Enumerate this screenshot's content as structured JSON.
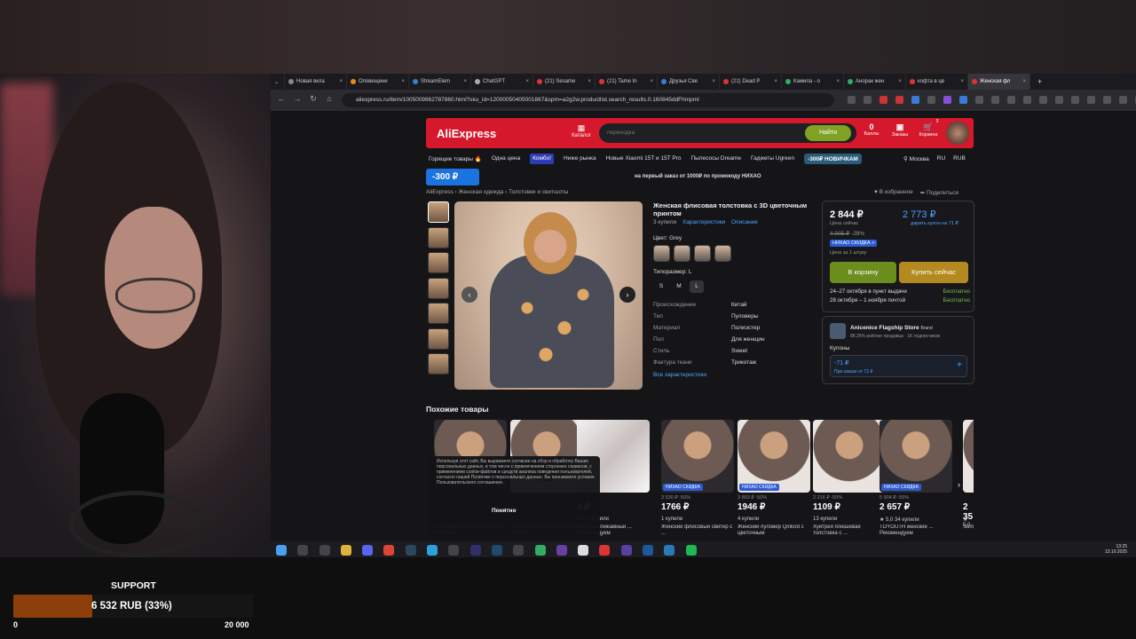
{
  "browser": {
    "tabs": [
      {
        "label": "Новая вкла"
      },
      {
        "label": "Оповещени"
      },
      {
        "label": "StreamElem"
      },
      {
        "label": "ChatGPT"
      },
      {
        "label": "(21) Sesame"
      },
      {
        "label": "(21) Tame In"
      },
      {
        "label": "Друзья Све"
      },
      {
        "label": "(21) Dead P"
      },
      {
        "label": "Камила - о"
      },
      {
        "label": "Анорак жен"
      },
      {
        "label": "кофта в цв"
      },
      {
        "label": "Женская фл"
      }
    ],
    "url": "aliexpress.ru/item/1005009862787860.html?sku_id=12000050405001867&spm=a2g2w.productlist.search_results.0.160845ddFhmpml"
  },
  "header": {
    "logo": "AliExpress",
    "catalog": "Каталог",
    "search_placeholder": "переходка",
    "search_button": "Найти",
    "points_count": "0",
    "points_label": "Баллы",
    "orders_label": "Заказы",
    "cart_label": "Корзина",
    "cart_count": "3"
  },
  "categories": [
    "Горящие товары 🔥",
    "Одна цена",
    "Комбо!",
    "Ниже рынка",
    "Новые Xiaomi 15T и 15T Pro",
    "Пылесосы Dreame",
    "Гаджеты Ugreen",
    "-300₽ НОВИЧКАМ"
  ],
  "location": {
    "city": "Москва",
    "lang": "RU",
    "currency": "RUB"
  },
  "coupon_banner": "-300 ₽",
  "promo_text": "на первый заказ от 1000₽ по промокоду НИХАО",
  "breadcrumbs": "AliExpress  ›  Женская одежда  ›  Толстовки и свитшоты",
  "fav_actions": {
    "favorite": "♥ В избранное",
    "share": "➦ Поделиться"
  },
  "product": {
    "title": "Женская флисовая толстовка с 3D цветочным принтом",
    "purchases": "3 купили",
    "link_specs": "Характеристики",
    "link_desc": "Описание",
    "color_label": "Цвет: Grey",
    "size_label": "Типоразмер: L",
    "sizes": [
      "S",
      "M",
      "L"
    ],
    "specs": [
      {
        "k": "Происхождение",
        "v": "Китай"
      },
      {
        "k": "Тип",
        "v": "Пуловеры"
      },
      {
        "k": "Материал",
        "v": "Полиэстер"
      },
      {
        "k": "Пол",
        "v": "Для женщин"
      },
      {
        "k": "Стиль",
        "v": "Sweet"
      },
      {
        "k": "Фактура ткани",
        "v": "Трикотаж"
      }
    ],
    "all_specs": "Все характеристики"
  },
  "buybox": {
    "price": "2 844 ₽",
    "price_sub": "Цена сейчас",
    "price_coupon": "2 773 ₽",
    "price_coupon_sub": "дарить купон на 71 ₽",
    "old_price": "4 005 ₽",
    "discount": "-29%",
    "badge": "НИХАО СКИДКА >",
    "per_piece": "Цена за 1 штуку",
    "cart_btn": "В корзину",
    "buy_btn": "Купить сейчас",
    "delivery": [
      {
        "text": "24–27 октября в пункт выдачи",
        "price": "Бесплатно"
      },
      {
        "text": "28 октября – 1 ноября почтой",
        "price": "Бесплатно"
      }
    ]
  },
  "store": {
    "name": "Anicenice Flagship Store",
    "brand": "Brand",
    "sub": "88,35% рейтинг продавца · 1K подписчиков",
    "coupons_label": "Купоны",
    "coupon_value": "-71 ₽",
    "coupon_sub": "При заказе от 72 ₽"
  },
  "similar": {
    "title": "Похожие товары",
    "items": [
      {
        "old": "",
        "price": "",
        "sold": "",
        "name": "Bornladies женский пуловер из кролик с",
        "tag": ""
      },
      {
        "old": "",
        "price": "",
        "sold": "",
        "name": "Yaminiya женский флисовый свитер с",
        "tag": ""
      },
      {
        "old": "",
        "price": "4 ₽",
        "sold": "1 971 купили",
        "name": "Женский пижамный ... Рекомендуем",
        "tag": ""
      },
      {
        "old": "3 530 ₽ -50%",
        "price": "1766 ₽",
        "sold": "1 купили",
        "name": "Женский флисовый свитер с ...",
        "tag": "НИХАО СКИДКА"
      },
      {
        "old": "3 893 ₽ -50%",
        "price": "1946 ₽",
        "sold": "4 купили",
        "name": "Женский пуловер Qinlord с цветочным",
        "tag": "НИХАО СКИДКА"
      },
      {
        "old": "2 216 ₽ -50%",
        "price": "1109 ₽",
        "sold": "13 купили",
        "name": "Хуйтрея плюшевая толстовка с ...",
        "tag": ""
      },
      {
        "old": "5 904 ₽ -55%",
        "price": "2 657 ₽",
        "sold": "★ 5,0  34 купили",
        "name": "TOYOUTH женские ... Рекомендуем",
        "tag": "НИХАО СКИДКА"
      },
      {
        "old": "",
        "price": "2 35",
        "sold": "★ 5,0",
        "name": "Sumu",
        "tag": ""
      }
    ]
  },
  "cookie": {
    "text": "Используя этот сайт, Вы выражаете согласие на сбор и обработку Ваших персональных данных, в том числе с привлечением сторонних сервисов, с применением cookie-файлов и средств анализа поведения пользователей, согласно нашей Политике о персональных данных. Вы принимаете условия Пользовательского соглашения.",
    "button": "Понятно"
  },
  "taskbar": {
    "time": "13:25",
    "date": "13.10.2025"
  },
  "donation": {
    "label": "SUPPORT",
    "text": "6 532 RUB (33%)",
    "min": "0",
    "max": "20 000",
    "progress": 0.33
  }
}
